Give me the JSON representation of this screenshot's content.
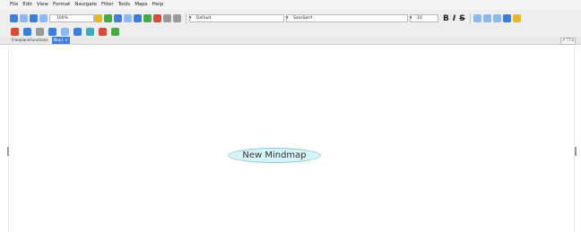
{
  "menu": [
    "File",
    "Edit",
    "View",
    "Format",
    "Navigate",
    "Filter",
    "Tools",
    "Maps",
    "Help"
  ],
  "toolbar": {
    "zoom": "100%",
    "style": "Default",
    "font_family": "SansSerif",
    "font_size": "10",
    "bold_label": "B",
    "italic_label": "I",
    "strike_label": "S"
  },
  "tabs": [
    {
      "label": "FreeplaneFunctions"
    },
    {
      "label": "Map1",
      "close": "x"
    }
  ],
  "window_controls": "↗ ❐ x",
  "node": {
    "text": "New Mindmap"
  },
  "colors": {
    "accent": "#3f7fd8",
    "node_fill": "#d6f4f7"
  }
}
